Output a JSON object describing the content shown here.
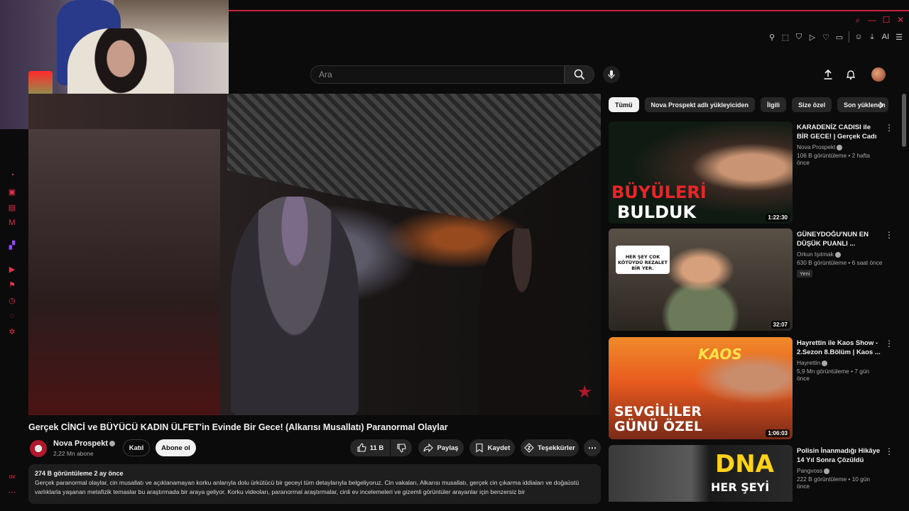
{
  "window": {
    "controls": [
      "search-icon",
      "minimize-icon",
      "maximize-icon",
      "close-icon"
    ]
  },
  "extensions": {
    "ai_label": "AI"
  },
  "search": {
    "placeholder": "Ara"
  },
  "video": {
    "title": "Gerçek CİNCİ ve BÜYÜCÜ KADIN ÜLFET'in Evinde Bir Gece! (Alkarısı Musallatı) Paranormal Olaylar",
    "channel": "Nova Prospekt",
    "subscribers": "2,22 Mn abone",
    "join_label": "Katıl",
    "subscribe_label": "Abone ol",
    "likes": "11 B",
    "share_label": "Paylaş",
    "save_label": "Kaydet",
    "thanks_label": "Teşekkürler",
    "views_date": "274 B görüntüleme  2 ay önce",
    "description": "Gerçek paranormal olaylar, cin musallatı ve açıklanamayan korku anlarıyla dolu ürkütücü bir geceyi tüm detaylarıyla belgeliyoruz. Cin vakaları, Alkarısı musallatı, gerçek cin çıkarma iddiaları ve doğaüstü varlıklarla yaşanan metafizik temaslar bu araştırmada bir araya geliyor. Korku videoları, paranormal araştırmalar, cinli ev incelemeleri ve gizemli görüntüler arayanlar için benzersiz bir"
  },
  "chips": [
    "Tümü",
    "Nova Prospekt adlı yükleyiciden",
    "İlgili",
    "Size özel",
    "Son yüklenen"
  ],
  "recommendations": [
    {
      "title": "KARADENİZ CADISI ile BİR GECE! | Gerçek Cadı Evi ve ...",
      "channel": "Nova Prospekt",
      "meta": "106 B görüntüleme • 2 hafta önce",
      "duration": "1:22:30",
      "thumb_text_1": "BÜYÜLERİ",
      "thumb_text_2": "BULDUK",
      "badge": ""
    },
    {
      "title": "GÜNEYDOĞU'NUN EN DÜŞÜK PUANLI ...",
      "channel": "Orkun Işıtmak",
      "meta": "630 B görüntüleme • 6 saat önce",
      "duration": "32:07",
      "thumb_text_1": "HER ŞEY ÇOK KÖTÜYDÜ REZALET BİR YER.",
      "thumb_text_2": "",
      "badge": "Yeni"
    },
    {
      "title": "Hayrettin ile Kaos Show - 2.Sezon 8.Bölüm | Kaos ...",
      "channel": "Hayrettin",
      "meta": "5,9 Mn görüntüleme • 7 gün önce",
      "duration": "1:06:03",
      "thumb_text_1": "SEVGİLİLER",
      "thumb_text_2": "GÜNÜ ÖZEL",
      "badge": ""
    },
    {
      "title": "Polisin İnanmadığı Hikâye 14 Yıl Sonra Çözüldü",
      "channel": "Pangvoss",
      "meta": "222 B görüntüleme • 10 gün önce",
      "duration": "",
      "thumb_text_1": "DNA",
      "thumb_text_2": "HER ŞEYİ",
      "badge": ""
    }
  ]
}
